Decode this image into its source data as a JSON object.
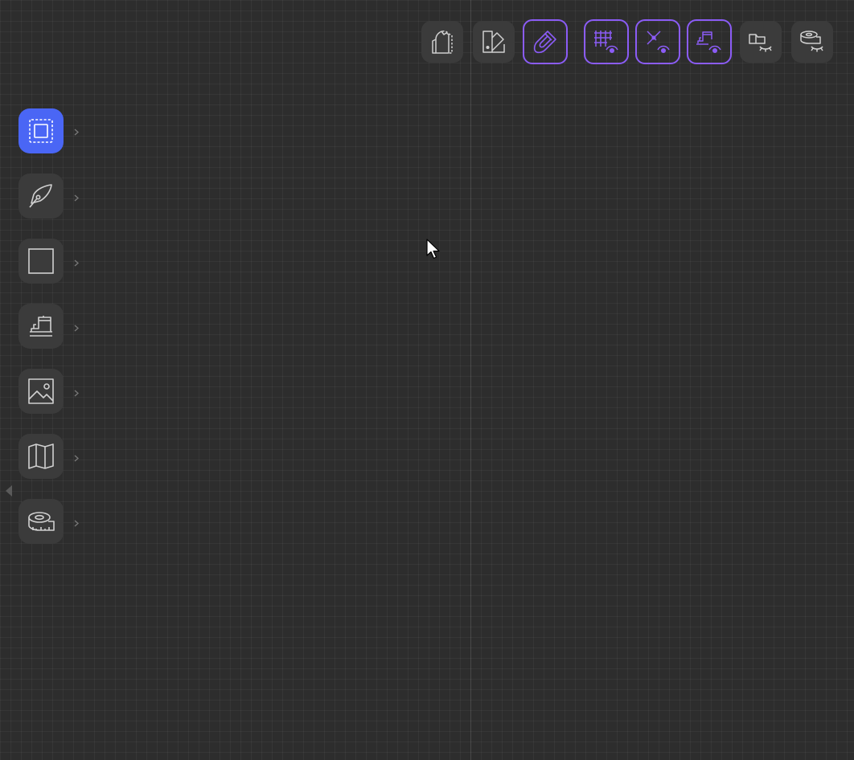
{
  "colors": {
    "canvas_bg": "#2d2d2d",
    "tool_bg": "#3b3b3b",
    "active_tool_bg": "#4a66f5",
    "toggle_outline": "#8b5cf6",
    "icon_stroke": "#d0d0d0"
  },
  "left_toolbar": {
    "tools": [
      {
        "name": "select-tool",
        "icon": "dashed-selection-icon",
        "active": true
      },
      {
        "name": "pen-tool",
        "icon": "pen-nib-icon",
        "active": false
      },
      {
        "name": "rectangle-tool",
        "icon": "square-icon",
        "active": false
      },
      {
        "name": "sewing-tool",
        "icon": "sewing-machine-icon",
        "active": false
      },
      {
        "name": "image-tool",
        "icon": "image-icon",
        "active": false
      },
      {
        "name": "map-tool",
        "icon": "folded-map-icon",
        "active": false
      },
      {
        "name": "measure-tool",
        "icon": "tape-measure-icon",
        "active": false
      }
    ]
  },
  "top_toolbar": {
    "buttons": [
      {
        "name": "pattern-pieces-button",
        "icon": "pattern-pieces-icon",
        "toggled": false
      },
      {
        "name": "color-swatch-button",
        "icon": "swatch-icon",
        "toggled": false
      },
      {
        "name": "snap-magnet-button",
        "icon": "magnet-icon",
        "toggled": true
      },
      {
        "name": "grid-visibility-button",
        "icon": "grid-eye-icon",
        "toggled": true
      },
      {
        "name": "points-visibility-button",
        "icon": "point-eye-icon",
        "toggled": true
      },
      {
        "name": "seam-visibility-button",
        "icon": "sewing-eye-icon",
        "toggled": true
      },
      {
        "name": "labels-hidden-button",
        "icon": "label-closed-eye-icon",
        "toggled": false
      },
      {
        "name": "measure-hidden-button",
        "icon": "tape-closed-eye-icon",
        "toggled": false
      }
    ]
  }
}
